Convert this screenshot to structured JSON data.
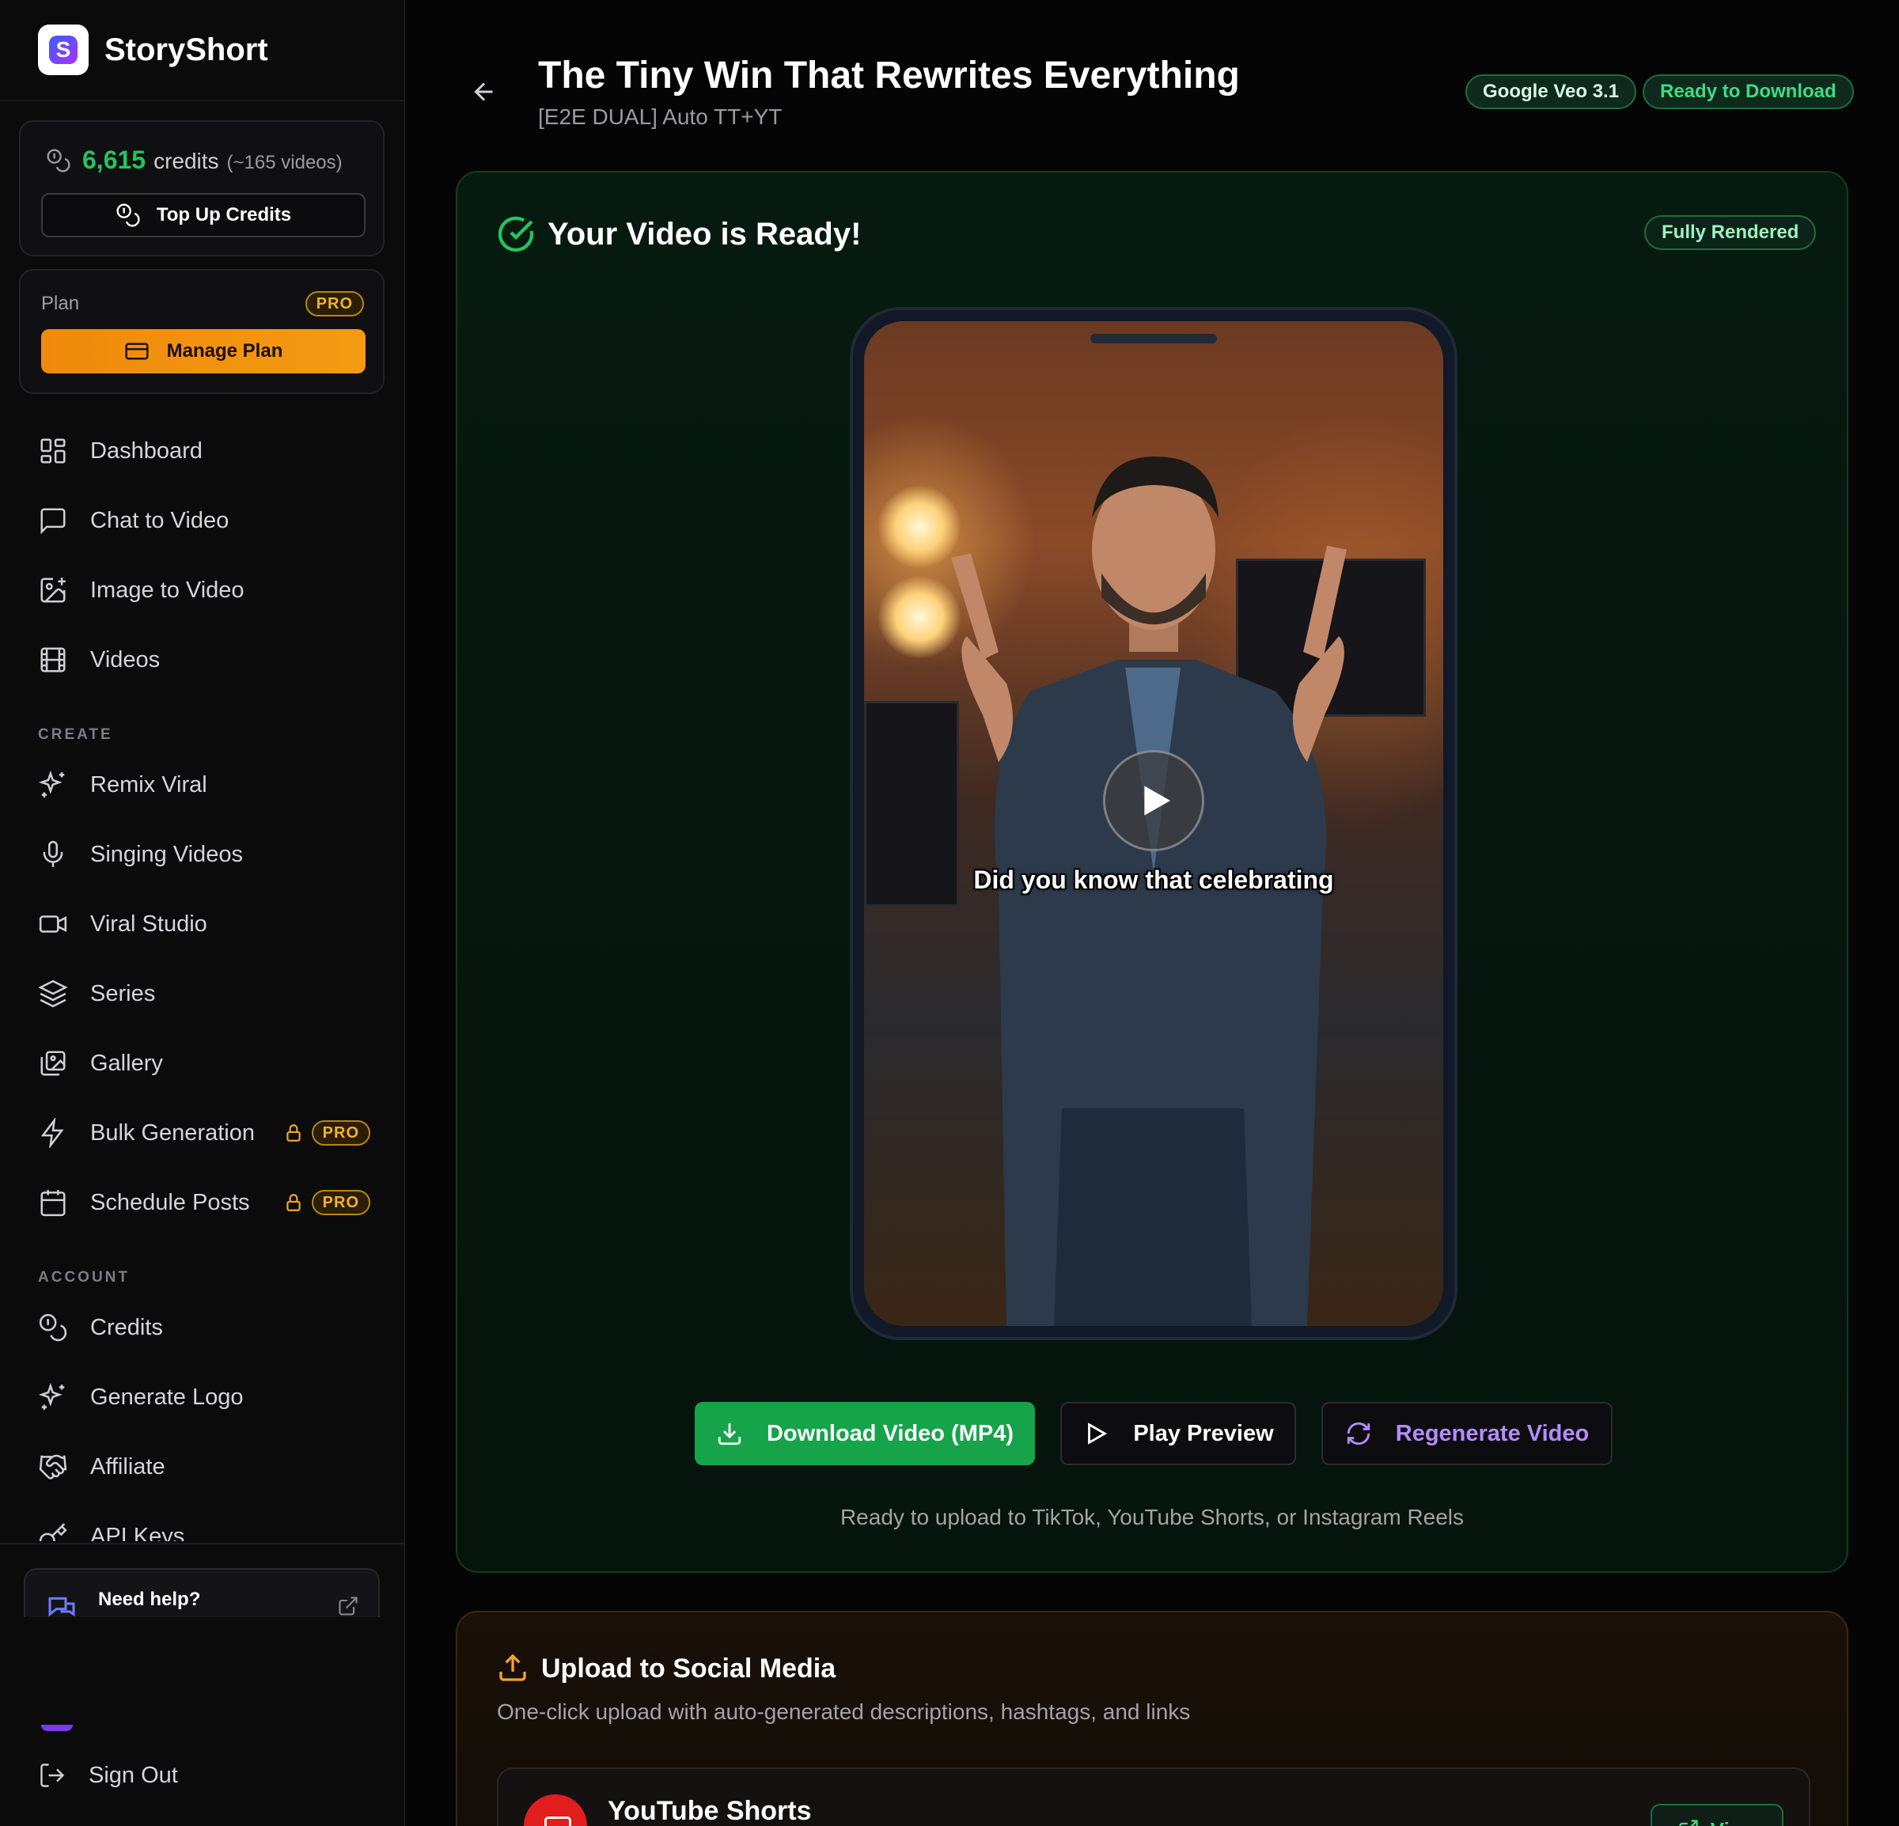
{
  "brand": {
    "name": "StoryShort",
    "logo_letter": "S"
  },
  "credits": {
    "amount": "6,615",
    "word": "credits",
    "videos": "(~165 videos)",
    "top_up_label": "Top Up Credits"
  },
  "plan": {
    "label": "Plan",
    "badge": "PRO",
    "manage_label": "Manage Plan"
  },
  "nav": {
    "main": [
      {
        "label": "Dashboard",
        "icon": "dashboard-icon"
      },
      {
        "label": "Chat to Video",
        "icon": "chat-icon"
      },
      {
        "label": "Image to Video",
        "icon": "image-plus-icon"
      },
      {
        "label": "Videos",
        "icon": "film-icon"
      }
    ],
    "create_label": "CREATE",
    "create": [
      {
        "label": "Remix Viral",
        "icon": "sparkles-icon"
      },
      {
        "label": "Singing Videos",
        "icon": "microphone-icon"
      },
      {
        "label": "Viral Studio",
        "icon": "video-camera-icon"
      },
      {
        "label": "Series",
        "icon": "layers-icon"
      },
      {
        "label": "Gallery",
        "icon": "gallery-icon"
      },
      {
        "label": "Bulk Generation",
        "icon": "bolt-icon",
        "badge": "PRO"
      },
      {
        "label": "Schedule Posts",
        "icon": "calendar-icon",
        "badge": "PRO"
      }
    ],
    "account_label": "ACCOUNT",
    "account": [
      {
        "label": "Credits",
        "icon": "coins-icon"
      },
      {
        "label": "Generate Logo",
        "icon": "sparkles-icon"
      },
      {
        "label": "Affiliate",
        "icon": "handshake-icon"
      },
      {
        "label": "API Keys",
        "icon": "key-icon"
      }
    ],
    "help_title": "Need help?",
    "sign_out": "Sign Out"
  },
  "header": {
    "title": "The Tiny Win That Rewrites Everything",
    "subtitle": "[E2E DUAL] Auto TT+YT",
    "model_badge": "Google Veo 3.1",
    "status_badge": "Ready to Download"
  },
  "ready": {
    "title": "Your Video is Ready!",
    "badge": "Fully Rendered",
    "caption": "Did you know that celebrating",
    "download_label": "Download Video (MP4)",
    "preview_label": "Play Preview",
    "regenerate_label": "Regenerate Video",
    "note": "Ready to upload to TikTok, YouTube Shorts, or Instagram Reels"
  },
  "upload": {
    "title": "Upload to Social Media",
    "subtitle": "One-click upload with auto-generated descriptions, hashtags, and links",
    "platform": "YouTube Shorts",
    "view_label": "View"
  },
  "colors": {
    "accent_green": "#22c55e",
    "download_green": "#16a34a",
    "plan_orange": "#f08a0c",
    "regen_purple": "#b58cff",
    "pro_gold": "#f5b224"
  }
}
